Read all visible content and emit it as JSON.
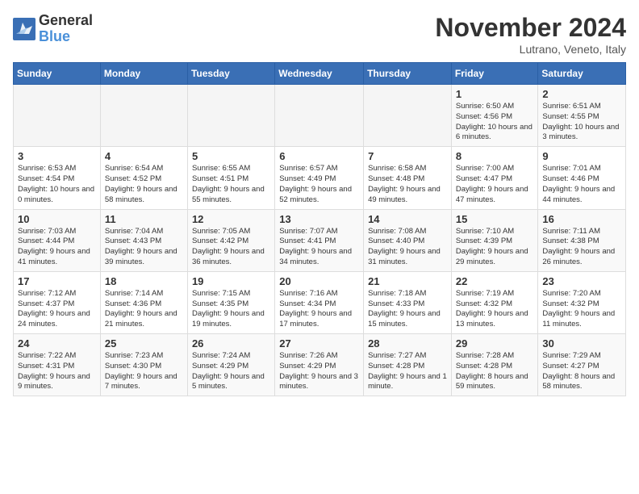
{
  "header": {
    "logo_line1": "General",
    "logo_line2": "Blue",
    "month_year": "November 2024",
    "location": "Lutrano, Veneto, Italy"
  },
  "weekdays": [
    "Sunday",
    "Monday",
    "Tuesday",
    "Wednesday",
    "Thursday",
    "Friday",
    "Saturday"
  ],
  "weeks": [
    [
      {
        "day": "",
        "info": ""
      },
      {
        "day": "",
        "info": ""
      },
      {
        "day": "",
        "info": ""
      },
      {
        "day": "",
        "info": ""
      },
      {
        "day": "",
        "info": ""
      },
      {
        "day": "1",
        "info": "Sunrise: 6:50 AM\nSunset: 4:56 PM\nDaylight: 10 hours and 6 minutes."
      },
      {
        "day": "2",
        "info": "Sunrise: 6:51 AM\nSunset: 4:55 PM\nDaylight: 10 hours and 3 minutes."
      }
    ],
    [
      {
        "day": "3",
        "info": "Sunrise: 6:53 AM\nSunset: 4:54 PM\nDaylight: 10 hours and 0 minutes."
      },
      {
        "day": "4",
        "info": "Sunrise: 6:54 AM\nSunset: 4:52 PM\nDaylight: 9 hours and 58 minutes."
      },
      {
        "day": "5",
        "info": "Sunrise: 6:55 AM\nSunset: 4:51 PM\nDaylight: 9 hours and 55 minutes."
      },
      {
        "day": "6",
        "info": "Sunrise: 6:57 AM\nSunset: 4:49 PM\nDaylight: 9 hours and 52 minutes."
      },
      {
        "day": "7",
        "info": "Sunrise: 6:58 AM\nSunset: 4:48 PM\nDaylight: 9 hours and 49 minutes."
      },
      {
        "day": "8",
        "info": "Sunrise: 7:00 AM\nSunset: 4:47 PM\nDaylight: 9 hours and 47 minutes."
      },
      {
        "day": "9",
        "info": "Sunrise: 7:01 AM\nSunset: 4:46 PM\nDaylight: 9 hours and 44 minutes."
      }
    ],
    [
      {
        "day": "10",
        "info": "Sunrise: 7:03 AM\nSunset: 4:44 PM\nDaylight: 9 hours and 41 minutes."
      },
      {
        "day": "11",
        "info": "Sunrise: 7:04 AM\nSunset: 4:43 PM\nDaylight: 9 hours and 39 minutes."
      },
      {
        "day": "12",
        "info": "Sunrise: 7:05 AM\nSunset: 4:42 PM\nDaylight: 9 hours and 36 minutes."
      },
      {
        "day": "13",
        "info": "Sunrise: 7:07 AM\nSunset: 4:41 PM\nDaylight: 9 hours and 34 minutes."
      },
      {
        "day": "14",
        "info": "Sunrise: 7:08 AM\nSunset: 4:40 PM\nDaylight: 9 hours and 31 minutes."
      },
      {
        "day": "15",
        "info": "Sunrise: 7:10 AM\nSunset: 4:39 PM\nDaylight: 9 hours and 29 minutes."
      },
      {
        "day": "16",
        "info": "Sunrise: 7:11 AM\nSunset: 4:38 PM\nDaylight: 9 hours and 26 minutes."
      }
    ],
    [
      {
        "day": "17",
        "info": "Sunrise: 7:12 AM\nSunset: 4:37 PM\nDaylight: 9 hours and 24 minutes."
      },
      {
        "day": "18",
        "info": "Sunrise: 7:14 AM\nSunset: 4:36 PM\nDaylight: 9 hours and 21 minutes."
      },
      {
        "day": "19",
        "info": "Sunrise: 7:15 AM\nSunset: 4:35 PM\nDaylight: 9 hours and 19 minutes."
      },
      {
        "day": "20",
        "info": "Sunrise: 7:16 AM\nSunset: 4:34 PM\nDaylight: 9 hours and 17 minutes."
      },
      {
        "day": "21",
        "info": "Sunrise: 7:18 AM\nSunset: 4:33 PM\nDaylight: 9 hours and 15 minutes."
      },
      {
        "day": "22",
        "info": "Sunrise: 7:19 AM\nSunset: 4:32 PM\nDaylight: 9 hours and 13 minutes."
      },
      {
        "day": "23",
        "info": "Sunrise: 7:20 AM\nSunset: 4:32 PM\nDaylight: 9 hours and 11 minutes."
      }
    ],
    [
      {
        "day": "24",
        "info": "Sunrise: 7:22 AM\nSunset: 4:31 PM\nDaylight: 9 hours and 9 minutes."
      },
      {
        "day": "25",
        "info": "Sunrise: 7:23 AM\nSunset: 4:30 PM\nDaylight: 9 hours and 7 minutes."
      },
      {
        "day": "26",
        "info": "Sunrise: 7:24 AM\nSunset: 4:29 PM\nDaylight: 9 hours and 5 minutes."
      },
      {
        "day": "27",
        "info": "Sunrise: 7:26 AM\nSunset: 4:29 PM\nDaylight: 9 hours and 3 minutes."
      },
      {
        "day": "28",
        "info": "Sunrise: 7:27 AM\nSunset: 4:28 PM\nDaylight: 9 hours and 1 minute."
      },
      {
        "day": "29",
        "info": "Sunrise: 7:28 AM\nSunset: 4:28 PM\nDaylight: 8 hours and 59 minutes."
      },
      {
        "day": "30",
        "info": "Sunrise: 7:29 AM\nSunset: 4:27 PM\nDaylight: 8 hours and 58 minutes."
      }
    ]
  ]
}
